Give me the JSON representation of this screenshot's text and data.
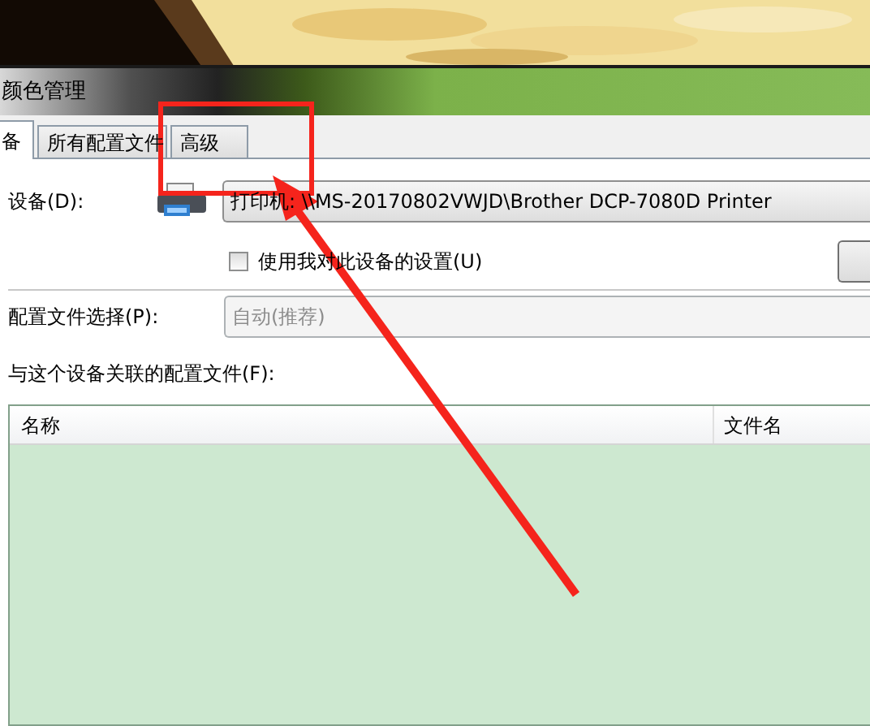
{
  "window": {
    "title": "颜色管理"
  },
  "tabs": [
    {
      "label": "备",
      "selected": true
    },
    {
      "label": "所有配置文件",
      "selected": false
    },
    {
      "label": "高级",
      "selected": false
    }
  ],
  "device": {
    "label": "设备(D):",
    "value": "打印机: \\\\MS-20170802VWJD\\Brother DCP-7080D Printer"
  },
  "use_my_settings": {
    "label": "使用我对此设备的设置(U)",
    "checked": false
  },
  "profile_selection": {
    "label": "配置文件选择(P):",
    "value": "自动(推荐)",
    "disabled": true
  },
  "associated_profiles": {
    "label": "与这个设备关联的配置文件(F):",
    "columns": [
      "名称",
      "文件名"
    ]
  },
  "annotation": {
    "box": true,
    "arrow": true
  }
}
